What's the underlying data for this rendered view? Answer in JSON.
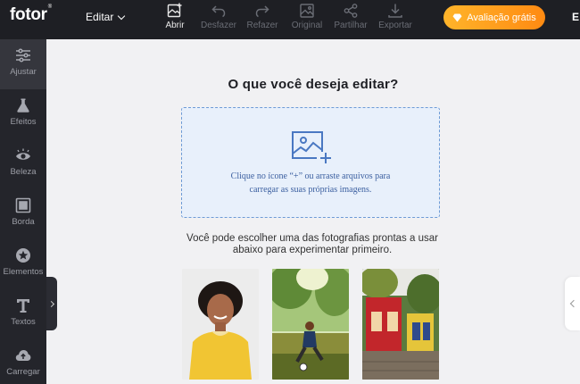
{
  "header": {
    "logo": "fotor",
    "logo_mark": "®",
    "menu_label": "Editar",
    "tools": [
      {
        "label": "Abrir",
        "icon": "open-image-icon",
        "enabled": true
      },
      {
        "label": "Desfazer",
        "icon": "undo-icon",
        "enabled": false
      },
      {
        "label": "Refazer",
        "icon": "redo-icon",
        "enabled": false
      },
      {
        "label": "Original",
        "icon": "original-image-icon",
        "enabled": false
      },
      {
        "label": "Partilhar",
        "icon": "share-icon",
        "enabled": false
      },
      {
        "label": "Exportar",
        "icon": "download-icon",
        "enabled": false
      }
    ],
    "premium_label": "Avaliação grátis",
    "premium_icon": "diamond-icon",
    "edge_letter": "E"
  },
  "sidebar": {
    "items": [
      {
        "label": "Ajustar",
        "icon": "sliders-icon"
      },
      {
        "label": "Efeitos",
        "icon": "flask-icon"
      },
      {
        "label": "Beleza",
        "icon": "eye-icon"
      },
      {
        "label": "Borda",
        "icon": "frame-icon"
      },
      {
        "label": "Elementos",
        "icon": "star-badge-icon"
      },
      {
        "label": "Textos",
        "icon": "text-icon"
      },
      {
        "label": "Carregar",
        "icon": "cloud-upload-icon"
      }
    ]
  },
  "main": {
    "title": "O que você deseja editar?",
    "dropzone_line1": "Clique no ícone “+” ou arraste arquivos para",
    "dropzone_line2": "carregar as suas próprias imagens.",
    "sample_line1": "Você pode escolher uma das fotografias prontas a usar",
    "sample_line2": "abaixo para experimentar primeiro."
  },
  "colors": {
    "topbar": "#1e1f24",
    "sidebar": "#24252b",
    "accent": "#ff9a1f",
    "dropzone_border": "#6e9bd6"
  }
}
